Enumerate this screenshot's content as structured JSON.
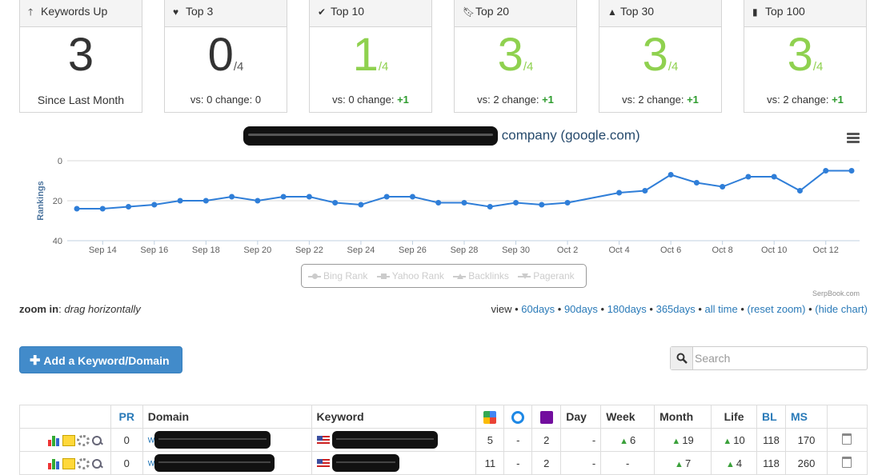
{
  "cards": [
    {
      "title": "Keywords Up",
      "icon": "arrow-up-icon",
      "value": "3",
      "of": "",
      "footer": "Since Last Month",
      "delta": "",
      "green": false
    },
    {
      "title": "Top 3",
      "icon": "heart-icon",
      "value": "0",
      "of": "/4",
      "footer": "vs: 0 change: 0",
      "delta": "",
      "green": false
    },
    {
      "title": "Top 10",
      "icon": "check-icon",
      "value": "1",
      "of": "/4",
      "footer": "vs: 0 change: ",
      "delta": "+1",
      "green": true
    },
    {
      "title": "Top 20",
      "icon": "bookmark-icon",
      "value": "3",
      "of": "/4",
      "footer": "vs: 2 change: ",
      "delta": "+1",
      "green": true
    },
    {
      "title": "Top 30",
      "icon": "road-icon",
      "value": "3",
      "of": "/4",
      "footer": "vs: 2 change: ",
      "delta": "+1",
      "green": true
    },
    {
      "title": "Top 100",
      "icon": "signal-icon",
      "value": "3",
      "of": "/4",
      "footer": "vs: 2 change: ",
      "delta": "+1",
      "green": true
    }
  ],
  "chart": {
    "title_suffix": "company (google.com)",
    "credit": "SerpBook.com",
    "legend": [
      "Bing Rank",
      "Yahoo Rank",
      "Backlinks",
      "Pagerank"
    ]
  },
  "chart_data": {
    "type": "line",
    "ylabel": "Rankings",
    "ylim": [
      40,
      0
    ],
    "yticks": [
      "0",
      "20",
      "40"
    ],
    "x": [
      "Sep 13",
      "Sep 14",
      "Sep 15",
      "Sep 16",
      "Sep 17",
      "Sep 18",
      "Sep 19",
      "Sep 20",
      "Sep 21",
      "Sep 22",
      "Sep 23",
      "Sep 24",
      "Sep 25",
      "Sep 26",
      "Sep 27",
      "Sep 28",
      "Sep 29",
      "Sep 30",
      "Oct 1",
      "Oct 2",
      "Oct 4",
      "Oct 5",
      "Oct 6",
      "Oct 7",
      "Oct 8",
      "Oct 9",
      "Oct 10",
      "Oct 11",
      "Oct 12",
      "Oct 13"
    ],
    "x_tick_labels": [
      "Sep 14",
      "Sep 16",
      "Sep 18",
      "Sep 20",
      "Sep 22",
      "Sep 24",
      "Sep 26",
      "Sep 28",
      "Sep 30",
      "Oct 2",
      "Oct 4",
      "Oct 6",
      "Oct 8",
      "Oct 10",
      "Oct 12"
    ],
    "series": [
      {
        "values": [
          24,
          24,
          23,
          22,
          20,
          20,
          18,
          20,
          18,
          18,
          21,
          22,
          18,
          18,
          21,
          21,
          23,
          21,
          22,
          21,
          16,
          15,
          7,
          11,
          13,
          8,
          8,
          15,
          5,
          5
        ],
        "color": "#2f7ed8"
      }
    ]
  },
  "zoom": {
    "label": "zoom in",
    "hint": "drag horizontally",
    "view": "view",
    "links": [
      "60days",
      "90days",
      "180days",
      "365days",
      "all time",
      "(reset zoom)",
      "(hide chart)"
    ]
  },
  "add_button": "Add a Keyword/Domain",
  "search": {
    "placeholder": "Search"
  },
  "table": {
    "headers": {
      "pr": "PR",
      "domain": "Domain",
      "keyword": "Keyword",
      "day": "Day",
      "week": "Week",
      "month": "Month",
      "life": "Life",
      "bl": "BL",
      "ms": "MS"
    },
    "rows": [
      {
        "pr": "0",
        "domain_prefix": "w",
        "google": "5",
        "bing": "-",
        "yahoo": "2",
        "day": "-",
        "week": "6",
        "month": "19",
        "life": "10",
        "bl": "118",
        "ms": "170",
        "week_up": true
      },
      {
        "pr": "0",
        "domain_prefix": "w",
        "google": "11",
        "bing": "-",
        "yahoo": "2",
        "day": "-",
        "week": "-",
        "month": "7",
        "life": "4",
        "bl": "118",
        "ms": "260",
        "week_up": false
      }
    ]
  }
}
